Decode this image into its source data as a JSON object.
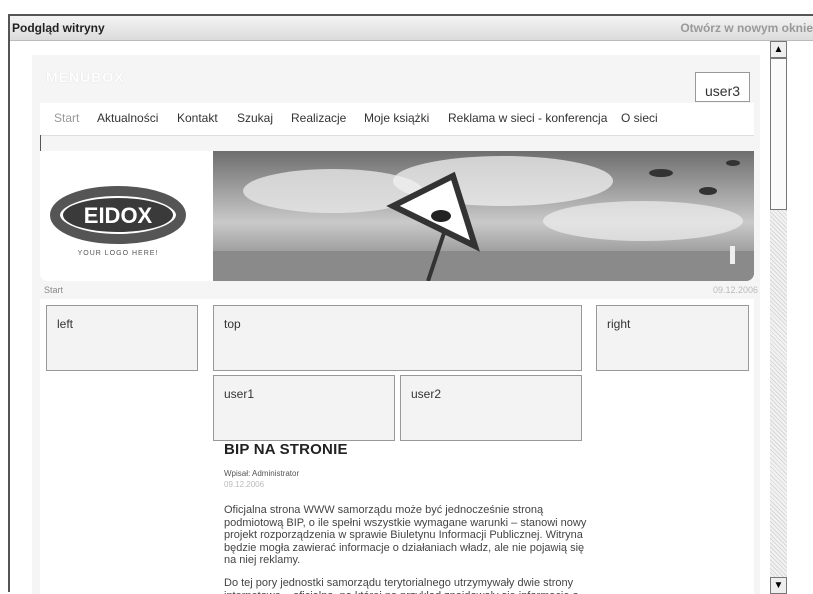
{
  "window": {
    "title": "Podgląd witryny",
    "open_new_window": "Otwórz w nowym oknie"
  },
  "site": {
    "brand": "MENUBOX",
    "nav": [
      "Start",
      "Aktualności",
      "Kontakt",
      "Szukaj",
      "Realizacje",
      "Moje książki",
      "Reklama w sieci - konferencja",
      "O sieci"
    ],
    "logo_text": "EIDOX",
    "logo_tagline": "YOUR LOGO HERE!",
    "breadcrumb": "Start",
    "date": "09.12.2006",
    "modules": {
      "user3": "user3",
      "left": "left",
      "top": "top",
      "right": "right",
      "user1": "user1",
      "user2": "user2"
    },
    "article": {
      "title": "BIP NA STRONIE",
      "author": "Wpisał: Administrator",
      "date": "09.12.2006",
      "paragraph1": "Oficjalna strona WWW samorządu może być jednocześnie stroną podmiotową BIP, o ile spełni wszystkie wymagane warunki – stanowi nowy projekt rozporządzenia w sprawie Biuletynu Informacji Publicznej. Witryna będzie mogła zawierać informacje o działaniach władz, ale nie pojawią się na niej reklamy.",
      "paragraph2": "Do tej pory jednostki samorządu terytorialnego utrzymywały dwie strony internetowe – oficjalną, na której na przykład znajdowały się informacje o"
    }
  },
  "colors": {
    "frame": "#555555",
    "page_bg": "#f5f5f5",
    "module_bg": "#f3f3f3",
    "muted_text": "#999999"
  },
  "icons": {
    "scroll_up": "scroll-up-arrow-icon",
    "scroll_down": "scroll-down-arrow-icon"
  }
}
